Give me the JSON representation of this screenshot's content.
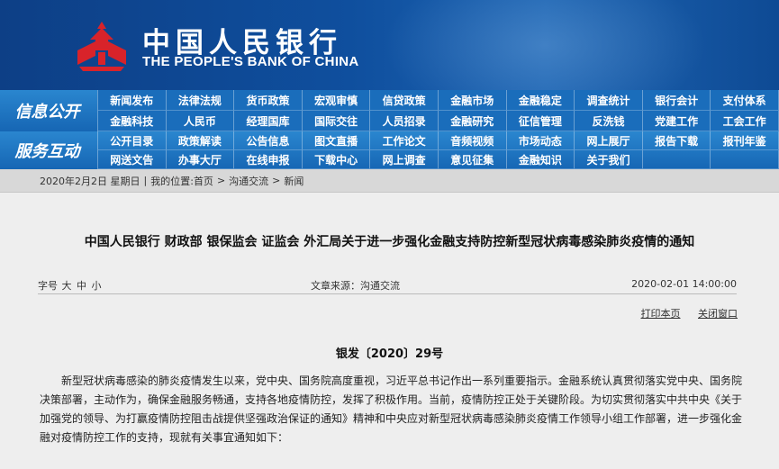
{
  "header": {
    "bank_name_cn": "中国人民银行",
    "bank_name_en": "THE PEOPLE'S BANK OF CHINA",
    "logo_icon": "pboc-logo-icon",
    "colors": {
      "banner": "#0f4f9e",
      "nav": "#1a6dbb",
      "logo_red": "#d8232a"
    }
  },
  "nav": {
    "section1_label": "信息公开",
    "section1_items": [
      "新闻发布",
      "法律法规",
      "货币政策",
      "宏观审慎",
      "信贷政策",
      "金融市场",
      "金融稳定",
      "调查统计",
      "银行会计",
      "支付体系",
      "金融科技",
      "人民币",
      "经理国库",
      "国际交往",
      "人员招录",
      "金融研究",
      "征信管理",
      "反洗钱",
      "党建工作",
      "工会工作"
    ],
    "section2_label": "服务互动",
    "section2_items": [
      "公开目录",
      "政策解读",
      "公告信息",
      "图文直播",
      "工作论文",
      "音频视频",
      "市场动态",
      "网上展厅",
      "报告下载",
      "报刊年鉴",
      "网送文告",
      "办事大厅",
      "在线申报",
      "下载中心",
      "网上调查",
      "意见征集",
      "金融知识",
      "关于我们",
      "",
      ""
    ]
  },
  "breadcrumb": {
    "date": "2020年2月2日 星期日",
    "location_label": "我的位置:",
    "path": [
      "首页",
      "沟通交流",
      "新闻"
    ]
  },
  "article": {
    "title": "中国人民银行 财政部 银保监会 证监会 外汇局关于进一步强化金融支持防控新型冠状病毒感染肺炎疫情的通知",
    "font_size_label": "字号",
    "font_sizes": [
      "大",
      "中",
      "小"
    ],
    "source": "文章来源：沟通交流",
    "datetime": "2020-02-01 14:00:00",
    "print_label": "打印本页",
    "close_label": "关闭窗口",
    "doc_number": "银发〔2020〕29号",
    "paragraph": "新型冠状病毒感染的肺炎疫情发生以来，党中央、国务院高度重视，习近平总书记作出一系列重要指示。金融系统认真贯彻落实党中央、国务院决策部署，主动作为，确保金融服务畅通，支持各地疫情防控，发挥了积极作用。当前，疫情防控正处于关键阶段。为切实贯彻落实中共中央《关于加强党的领导、为打赢疫情防控阻击战提供坚强政治保证的通知》精神和中央应对新型冠状病毒感染肺炎疫情工作领导小组工作部署，进一步强化金融对疫情防控工作的支持，现就有关事宜通知如下："
  }
}
